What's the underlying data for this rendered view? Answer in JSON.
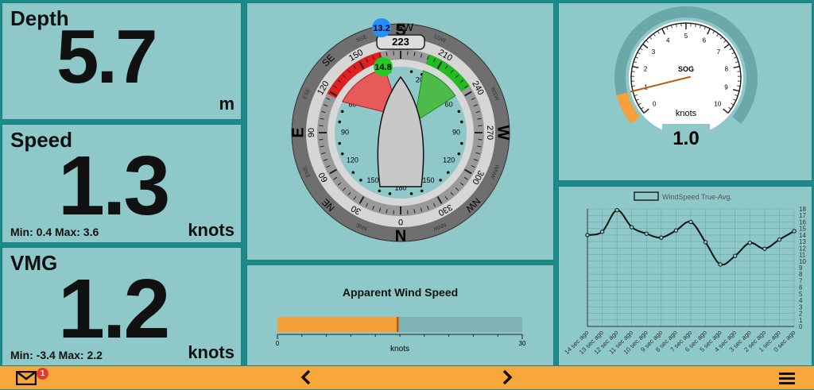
{
  "depth": {
    "title": "Depth",
    "value": "5.7",
    "unit": "m"
  },
  "speed": {
    "title": "Speed",
    "value": "1.3",
    "unit": "knots",
    "minmax": "Min: 0.4 Max: 3.6"
  },
  "vmg": {
    "title": "VMG",
    "value": "1.2",
    "unit": "knots",
    "minmax": "Min: -3.4 Max: 2.2"
  },
  "wind_dial": {
    "heading": "223",
    "heading_cardinal": "SW",
    "true_wind_badge": "13.2",
    "apparent_wind_badge": "14.8",
    "cardinals": [
      "S",
      "W",
      "N",
      "E"
    ],
    "intercardinals": [
      "SW",
      "NW",
      "NE",
      "SE"
    ],
    "small_labels": [
      "SSW",
      "WSW",
      "WNW",
      "NNW",
      "NNE",
      "ENE",
      "ESE",
      "SSE"
    ],
    "relative_labels": [
      "20",
      "40",
      "60",
      "90",
      "120",
      "150",
      "180",
      "150",
      "120",
      "90",
      "60",
      "30"
    ],
    "degree_labels": [
      "180",
      "210",
      "240",
      "270",
      "300",
      "330",
      "0",
      "30",
      "60",
      "90",
      "120",
      "150"
    ]
  },
  "aws": {
    "title": "Apparent Wind Speed",
    "unit": "knots",
    "min": "0",
    "max": "30",
    "value": 14.8,
    "max_value": 30
  },
  "sog": {
    "label": "SOG",
    "unit": "knots",
    "value": "1.0",
    "value_num": 1.0,
    "min": 0,
    "max": 10,
    "ticks": [
      "0",
      "1",
      "2",
      "3",
      "4",
      "5",
      "6",
      "7",
      "8",
      "9",
      "10"
    ]
  },
  "chart_data": {
    "type": "line",
    "legend": "WindSpeed True-Avg.",
    "x": [
      "14 sec ago",
      "13 sec ago",
      "12 sec ago",
      "11 sec ago",
      "10 sec ago",
      "9 sec ago",
      "8 sec ago",
      "7 sec ago",
      "6 sec ago",
      "5 sec ago",
      "4 sec ago",
      "3 sec ago",
      "2 sec ago",
      "1 sec ago",
      "0 sec ago"
    ],
    "series": [
      {
        "name": "WindSpeed True-Avg.",
        "values": [
          14,
          14.5,
          17.8,
          15.2,
          14.2,
          13.6,
          14.7,
          16,
          12.9,
          9.5,
          10.8,
          12.8,
          11.9,
          13.3,
          14.6
        ]
      }
    ],
    "ylim": [
      0,
      18
    ],
    "yticks": [
      "0",
      "1",
      "2",
      "3",
      "4",
      "5",
      "6",
      "7",
      "8",
      "9",
      "10",
      "11",
      "12",
      "13",
      "14",
      "15",
      "16",
      "17",
      "18"
    ],
    "grid": true,
    "legend_position": "top"
  },
  "footer": {
    "notification_count": "1",
    "colors": {
      "bar": "#f8a73a",
      "badge": "#e53935"
    },
    "icons": [
      "mail-icon",
      "chevron-left-icon",
      "chevron-right-icon",
      "menu-icon"
    ]
  },
  "colors": {
    "panel": "#8fc8c9",
    "border": "#1a7f80",
    "port": "#e02020",
    "starboard": "#22bb22",
    "bar": "#f5a03a",
    "track": "#7fb3b3"
  }
}
